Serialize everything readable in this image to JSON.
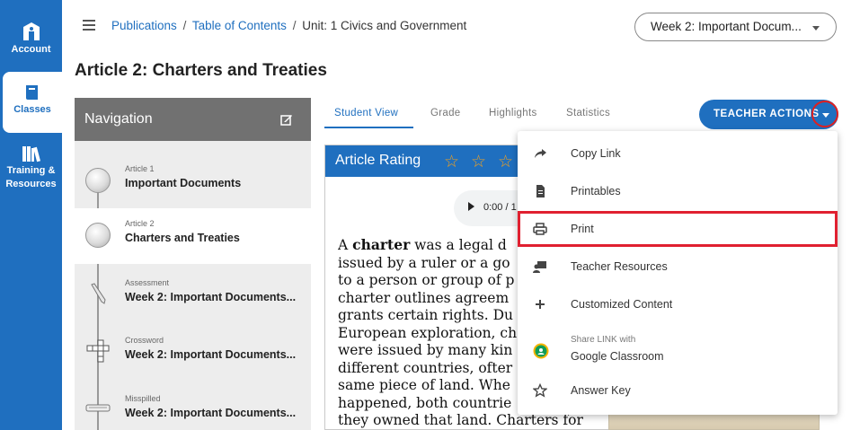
{
  "sidebar": {
    "items": [
      {
        "label": "Account",
        "icon": "account-icon"
      },
      {
        "label": "Classes",
        "icon": "book-icon"
      },
      {
        "label": "Training &",
        "label2": "Resources",
        "icon": "books-icon"
      }
    ]
  },
  "breadcrumb": {
    "publications": "Publications",
    "sep": "/",
    "toc": "Table of Contents",
    "current": "Unit: 1 Civics and Government"
  },
  "week_select": {
    "value": "Week 2: Important Docum..."
  },
  "page_title": "Article 2: Charters and Treaties",
  "navigation": {
    "title": "Navigation",
    "items": [
      {
        "type": "Article 1",
        "name": "Important Documents",
        "icon": "bead-icon"
      },
      {
        "type": "Article 2",
        "name": "Charters and Treaties",
        "icon": "bead-icon"
      },
      {
        "type": "Assessment",
        "name": "Week 2: Important Documents...",
        "icon": "pencil-icon"
      },
      {
        "type": "Crossword",
        "name": "Week 2: Important Documents...",
        "icon": "crossword-icon"
      },
      {
        "type": "Misspilled",
        "name": "Week 2: Important Documents...",
        "icon": "misspelled-icon"
      }
    ]
  },
  "tabs": [
    "Student View",
    "Grade",
    "Highlights",
    "Statistics"
  ],
  "teacher_actions": {
    "label": "TEACHER ACTIONS"
  },
  "article": {
    "rating_label": "Article Rating",
    "audio_time": "0:00 / 1",
    "text_lead": "A ",
    "text_bold": "charter",
    "text_rest": " was a legal d\nissued by a ruler or a go\nto a person or group of p\ncharter outlines agreem\ngrants certain rights. Du\nEuropean exploration, ch\nwere issued by many kin\ndifferent countries, ofter\nsame piece of land. Whe\nhappened, both countrie\nthey owned that land. Charters for"
  },
  "dropdown": {
    "items": [
      {
        "label": "Copy Link",
        "icon": "share-arrow-icon"
      },
      {
        "label": "Printables",
        "icon": "document-icon"
      },
      {
        "label": "Print",
        "icon": "printer-icon"
      },
      {
        "label": "Teacher Resources",
        "icon": "teacher-icon"
      },
      {
        "label": "Customized Content",
        "icon": "plus-icon"
      },
      {
        "sub": "Share LINK with",
        "label": "Google Classroom",
        "icon": "google-classroom-icon"
      },
      {
        "label": "Answer Key",
        "icon": "star-outline-icon"
      }
    ]
  },
  "colors": {
    "primary": "#1f6fbf",
    "highlight": "#e02030",
    "nav_header": "#717171"
  }
}
